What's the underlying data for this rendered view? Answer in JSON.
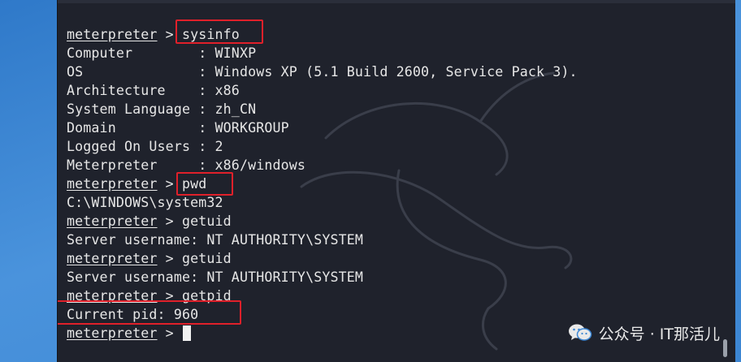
{
  "terminal": {
    "lines": [
      {
        "prompt": "meterpreter",
        "sep": " > ",
        "cmd": "sysinfo"
      },
      {
        "text": "Computer        : WINXP"
      },
      {
        "text": "OS              : Windows XP (5.1 Build 2600, Service Pack 3)."
      },
      {
        "text": "Architecture    : x86"
      },
      {
        "text": "System Language : zh_CN"
      },
      {
        "text": "Domain          : WORKGROUP"
      },
      {
        "text": "Logged On Users : 2"
      },
      {
        "text": "Meterpreter     : x86/windows"
      },
      {
        "prompt": "meterpreter",
        "sep": " > ",
        "cmd": "pwd"
      },
      {
        "text": "C:\\WINDOWS\\system32"
      },
      {
        "prompt": "meterpreter",
        "sep": " > ",
        "cmd": "getuid"
      },
      {
        "text": "Server username: NT AUTHORITY\\SYSTEM"
      },
      {
        "prompt": "meterpreter",
        "sep": " > ",
        "cmd": "getuid"
      },
      {
        "text": "Server username: NT AUTHORITY\\SYSTEM"
      },
      {
        "prompt": "meterpreter",
        "sep": " > ",
        "cmd": "getpid"
      },
      {
        "text": "Current pid: 960"
      },
      {
        "prompt": "meterpreter",
        "sep": " > ",
        "cmd": "",
        "cursor": true
      }
    ]
  },
  "watermark": {
    "text": "公众号 · IT那活儿",
    "icon": "wechat-icon"
  },
  "colors": {
    "terminal_bg": "#1f222c",
    "text": "#e6e6e6",
    "highlight_box": "#e0202a",
    "desktop_bg": "#3c86d3"
  }
}
